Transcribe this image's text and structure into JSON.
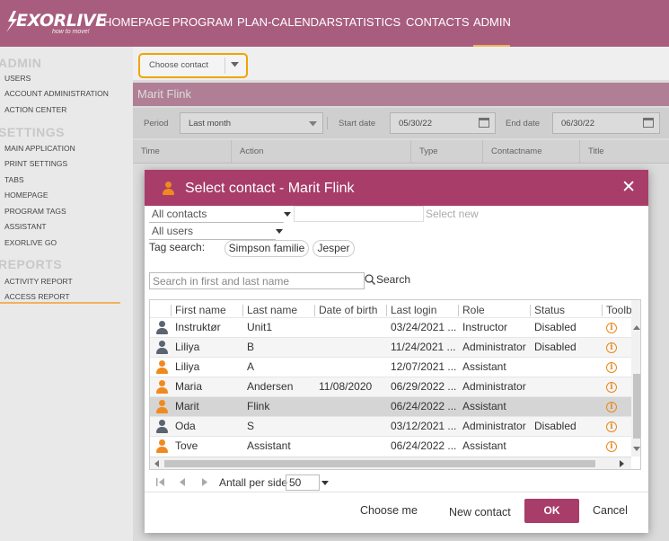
{
  "app": {
    "logo": "EXORLIVE",
    "tagline": "how to move!",
    "nav": [
      "HOMEPAGE",
      "PROGRAM",
      "PLAN-CALENDAR",
      "STATISTICS",
      "CONTACTS",
      "ADMIN"
    ],
    "active_nav": "ADMIN",
    "accent": "#f0b35e",
    "brand_color": "#a85d7e"
  },
  "sidebar": {
    "sections": [
      {
        "title": "ADMIN",
        "items": [
          "USERS",
          "ACCOUNT ADMINISTRATION",
          "ACTION CENTER"
        ]
      },
      {
        "title": "SETTINGS",
        "items": [
          "MAIN APPLICATION",
          "PRINT SETTINGS",
          "TABS",
          "HOMEPAGE",
          "PROGRAM TAGS",
          "ASSISTANT",
          "EXORLIVE GO"
        ]
      },
      {
        "title": "REPORTS",
        "items": [
          "ACTIVITY REPORT",
          "ACCESS REPORT"
        ]
      }
    ],
    "active_item": "ACCESS REPORT"
  },
  "report": {
    "choose_contact": "Choose contact",
    "contact_name": "Marit Flink",
    "period_label": "Period",
    "period_value": "Last month",
    "start_label": "Start date",
    "start_value": "05/30/22",
    "end_label": "End date",
    "end_value": "06/30/22",
    "columns": [
      "Time",
      "Action",
      "Type",
      "Contactname",
      "Title"
    ]
  },
  "modal": {
    "title": "Select contact - Marit Flink",
    "title_color": "#a83d6a",
    "contacts_filter": "All contacts",
    "select_new_placeholder": "Select new",
    "users_filter": "All users",
    "tag_search_label": "Tag search:",
    "tags": [
      "Simpson familie",
      "Jesper"
    ],
    "search_placeholder": "Search in first and last name",
    "search_label": "Search",
    "columns": [
      "First name",
      "Last name",
      "Date of birth",
      "Last login",
      "Role",
      "Status",
      "Toolbar"
    ],
    "rows": [
      {
        "icon": "gray",
        "first": "Instruktør",
        "last": "Unit1",
        "dob": "",
        "login": "03/24/2021 ...",
        "role": "Instructor",
        "status": "Disabled"
      },
      {
        "icon": "gray",
        "first": "Liliya",
        "last": "B",
        "dob": "",
        "login": "11/24/2021 ...",
        "role": "Administrator",
        "status": "Disabled"
      },
      {
        "icon": "orange",
        "first": "Liliya",
        "last": "A",
        "dob": "",
        "login": "12/07/2021 ...",
        "role": "Assistant",
        "status": ""
      },
      {
        "icon": "orange",
        "first": "Maria",
        "last": "Andersen",
        "dob": "11/08/2020",
        "login": "06/29/2022 ...",
        "role": "Administrator",
        "status": ""
      },
      {
        "icon": "orange",
        "first": "Marit",
        "last": "Flink",
        "dob": "",
        "login": "06/24/2022 ...",
        "role": "Assistant",
        "status": ""
      },
      {
        "icon": "gray",
        "first": "Oda",
        "last": "S",
        "dob": "",
        "login": "03/12/2021 ...",
        "role": "Administrator",
        "status": "Disabled"
      },
      {
        "icon": "orange",
        "first": "Tove",
        "last": "Assistant",
        "dob": "",
        "login": "06/24/2022 ...",
        "role": "Assistant",
        "status": ""
      }
    ],
    "selected_row": 4,
    "pager_label": "Antall per side",
    "pager_value": "50",
    "buttons": {
      "choose_me": "Choose me",
      "new_contact": "New contact",
      "ok": "OK",
      "cancel": "Cancel"
    }
  }
}
